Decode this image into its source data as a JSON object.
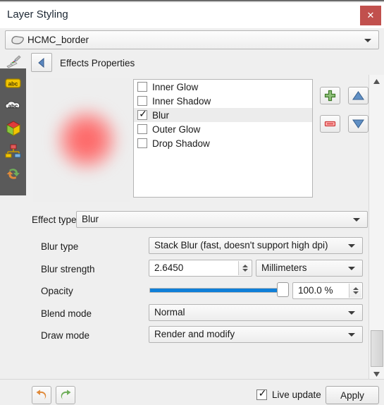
{
  "window": {
    "title": "Layer Styling",
    "close_label": "✕"
  },
  "layer_selector": {
    "layer_name": "HCMC_border",
    "icon": "polygon-layer-icon"
  },
  "tab_header": {
    "title": "Effects Properties",
    "back_icon": "back-arrow-icon",
    "brush_icon": "paintbrush-icon"
  },
  "sidebar": {
    "items": [
      {
        "icon": "labels-abc-icon"
      },
      {
        "icon": "masks-abc-icon"
      },
      {
        "icon": "3d-view-cube-icon"
      },
      {
        "icon": "diagrams-icon"
      },
      {
        "icon": "undo-redo-history-icon"
      }
    ]
  },
  "effects_list": {
    "items": [
      {
        "label": "Inner Glow",
        "checked": false,
        "selected": false
      },
      {
        "label": "Inner Shadow",
        "checked": false,
        "selected": false
      },
      {
        "label": "Blur",
        "checked": true,
        "selected": true
      },
      {
        "label": "Outer Glow",
        "checked": false,
        "selected": false
      },
      {
        "label": "Drop Shadow",
        "checked": false,
        "selected": false
      }
    ]
  },
  "list_tools": {
    "add": {
      "icon": "green-plus-icon"
    },
    "remove": {
      "icon": "red-minus-icon"
    },
    "move_up": {
      "icon": "blue-up-triangle-icon"
    },
    "move_down": {
      "icon": "blue-down-triangle-icon"
    }
  },
  "form": {
    "effect_type": {
      "label": "Effect type",
      "value": "Blur"
    },
    "blur_type": {
      "label": "Blur type",
      "value": "Stack Blur (fast, doesn't support high dpi)"
    },
    "blur_strength": {
      "label": "Blur strength",
      "value": "2.6450",
      "unit": "Millimeters"
    },
    "opacity": {
      "label": "Opacity",
      "value": "100.0 %",
      "percent": 100
    },
    "blend_mode": {
      "label": "Blend mode",
      "value": "Normal"
    },
    "draw_mode": {
      "label": "Draw mode",
      "value": "Render and modify"
    }
  },
  "footer": {
    "undo": {
      "icon": "undo-arrow-icon"
    },
    "redo": {
      "icon": "redo-arrow-icon"
    },
    "live_update": {
      "label": "Live update",
      "checked": true
    },
    "apply": {
      "label": "Apply"
    }
  },
  "colors": {
    "accent_blue": "#0f7fd8",
    "close_red": "#c1504d",
    "rail_gray": "#5a5a5a",
    "preview_blob": "#ff5a5a"
  }
}
